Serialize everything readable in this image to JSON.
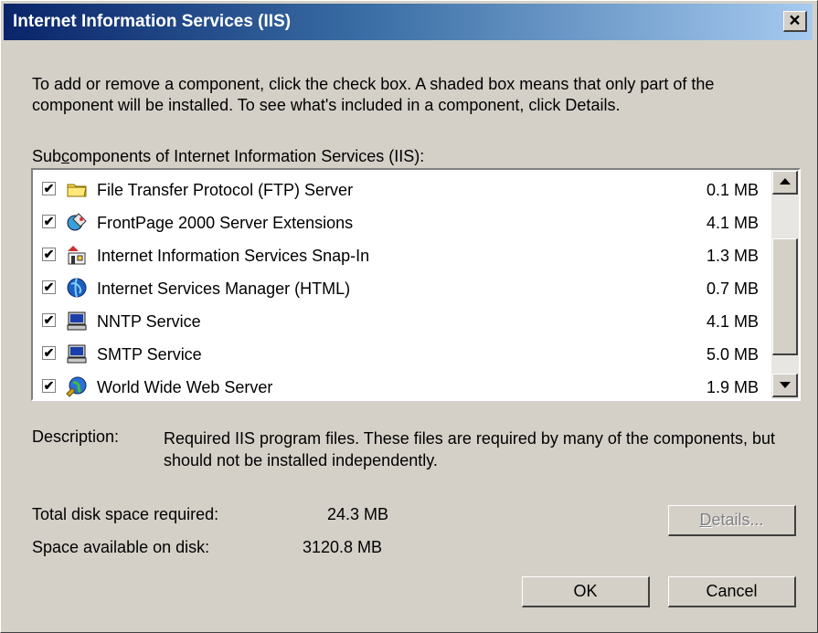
{
  "window": {
    "title": "Internet Information Services (IIS)",
    "close_glyph": "×"
  },
  "intro_text": "To add or remove a component, click the check box. A shaded box means that only part of the component will be installed. To see what's included in a component, click Details.",
  "subcomponents_label": {
    "prefix": "Sub",
    "access_key": "c",
    "suffix": "omponents of Internet Information Services (IIS):"
  },
  "components": [
    {
      "label": "File Transfer Protocol (FTP) Server",
      "size": "0.1 MB",
      "checked": true,
      "icon": "folder-icon"
    },
    {
      "label": "FrontPage 2000 Server Extensions",
      "size": "4.1 MB",
      "checked": true,
      "icon": "frontpage-icon"
    },
    {
      "label": "Internet Information Services Snap-In",
      "size": "1.3 MB",
      "checked": true,
      "icon": "snap-in-icon"
    },
    {
      "label": "Internet Services Manager (HTML)",
      "size": "0.7 MB",
      "checked": true,
      "icon": "globe-icon"
    },
    {
      "label": "NNTP Service",
      "size": "4.1 MB",
      "checked": true,
      "icon": "computer-icon"
    },
    {
      "label": "SMTP Service",
      "size": "5.0 MB",
      "checked": true,
      "icon": "computer-icon"
    },
    {
      "label": "World Wide Web Server",
      "size": "1.9 MB",
      "checked": true,
      "icon": "www-globe-icon"
    }
  ],
  "check_glyph": "✔",
  "description": {
    "label": "Description:",
    "text": "Required IIS program files. These files are required by many of the components, but should not be installed independently."
  },
  "disk": {
    "total_label": "Total disk space required:",
    "total_value": "24.3 MB",
    "available_label": "Space available on disk:",
    "available_value": "3120.8 MB"
  },
  "buttons": {
    "details_access_key": "D",
    "details_rest": "etails...",
    "ok": "OK",
    "cancel": "Cancel"
  },
  "colors": {
    "titlebar_start": "#0a246a",
    "titlebar_end": "#a6caf0",
    "dialog_bg": "#d4d0c8"
  }
}
